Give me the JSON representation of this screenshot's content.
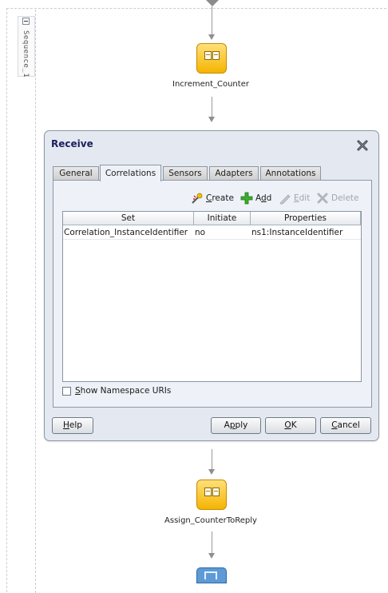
{
  "sequence": {
    "label": "Sequence_1"
  },
  "activities": {
    "increment": {
      "label": "Increment_Counter",
      "icon": "assign-icon"
    },
    "assign_reply": {
      "label": "Assign_CounterToReply",
      "icon": "assign-icon"
    },
    "next": {
      "icon": "reply-icon"
    }
  },
  "dialog": {
    "title": "Receive",
    "tabs": [
      {
        "label": "General",
        "active": false
      },
      {
        "label": "Correlations",
        "active": true
      },
      {
        "label": "Sensors",
        "active": false
      },
      {
        "label": "Adapters",
        "active": false
      },
      {
        "label": "Annotations",
        "active": false
      }
    ],
    "toolbar": {
      "create": {
        "mnemonic": "C",
        "rest": "reate"
      },
      "add": {
        "mnemonic": "d",
        "pre": "A",
        "rest": "d"
      },
      "edit": {
        "mnemonic": "E",
        "rest": "dit"
      },
      "delete": {
        "label": "Delete"
      }
    },
    "table": {
      "columns": [
        "Set",
        "Initiate",
        "Properties"
      ],
      "rows": [
        [
          "Correlation_InstanceIdentifier",
          "no",
          "ns1:InstanceIdentifier"
        ]
      ]
    },
    "checkbox": {
      "mnemonic": "S",
      "rest": "how Namespace URIs",
      "checked": false
    },
    "buttons": {
      "help": {
        "mnemonic": "H",
        "rest": "elp"
      },
      "apply": {
        "pre": "A",
        "mnemonic": "p",
        "rest": "ply"
      },
      "ok": {
        "mnemonic": "O",
        "rest": "K"
      },
      "cancel": {
        "mnemonic": "C",
        "rest": "ancel"
      }
    }
  },
  "colors": {
    "dialog_bg": "#e4e9f1",
    "activity_yellow": "#f5b400",
    "title_text": "#1b1f5e"
  }
}
